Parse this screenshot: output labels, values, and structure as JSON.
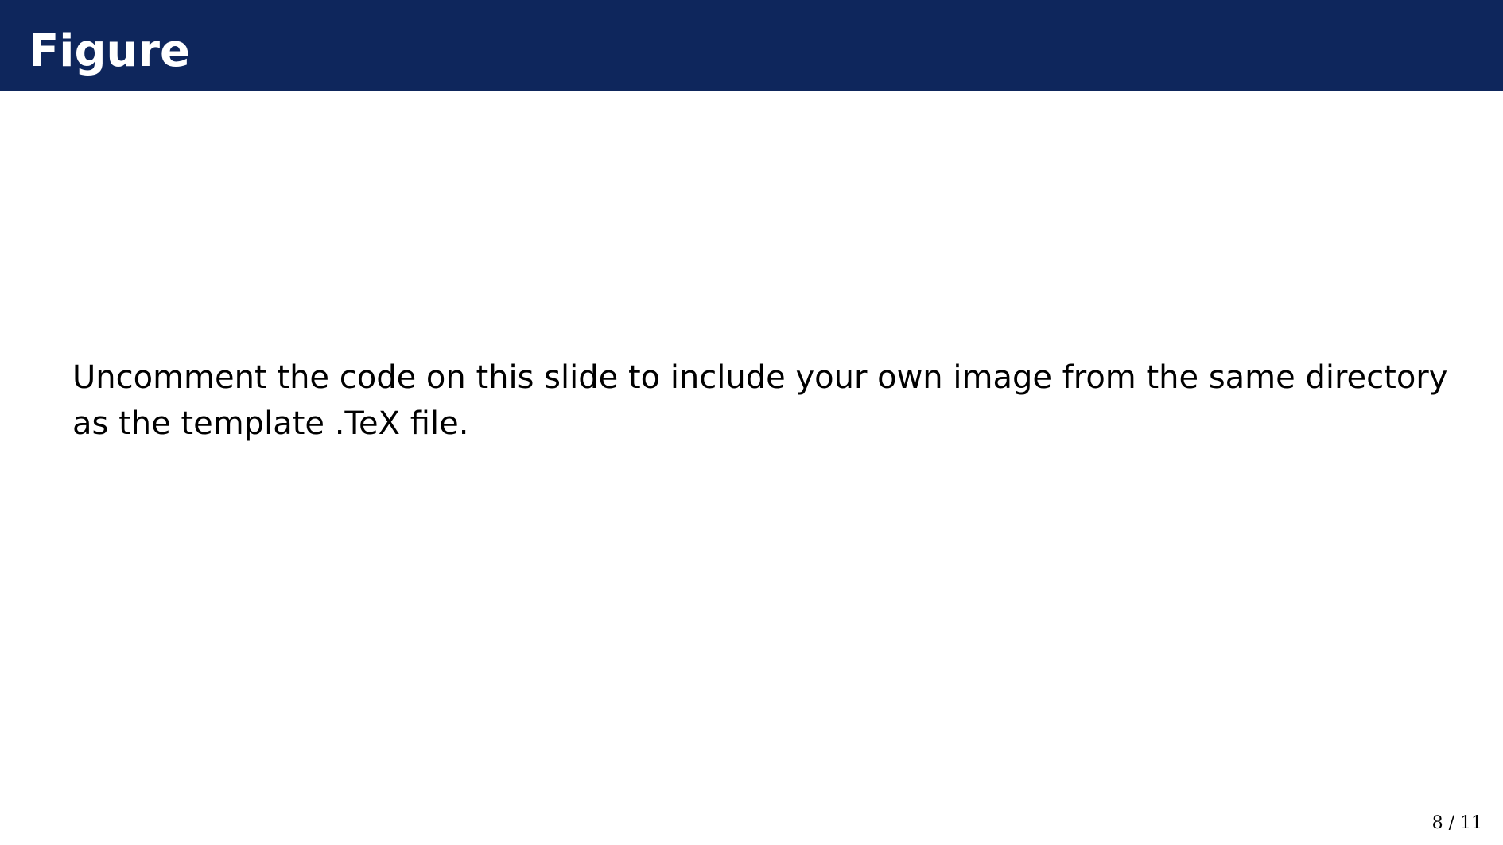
{
  "slide": {
    "title": "Figure",
    "body": "Uncomment the code on this slide to include your own image from the same directory as the template .TeX file.",
    "page_number": "8 / 11"
  },
  "colors": {
    "title_bar_background": "#0e265c",
    "title_text": "#ffffff",
    "body_text": "#000000"
  }
}
